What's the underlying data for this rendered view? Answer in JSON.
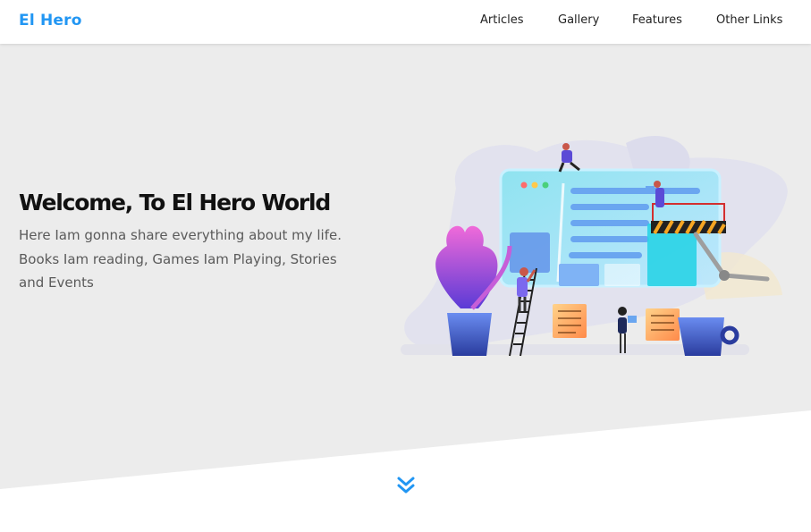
{
  "brand": "El Hero",
  "nav": {
    "items": [
      "Articles",
      "Gallery",
      "Features",
      "Other Links"
    ]
  },
  "hero": {
    "title": "Welcome, To El Hero World",
    "description": "Here Iam gonna share everything about my life. Books Iam reading, Games Iam Playing, Stories and Events"
  },
  "colors": {
    "accent": "#2196f3",
    "hero_bg": "#ececec"
  },
  "icons": {
    "scroll": "double-chevron-down-icon"
  }
}
